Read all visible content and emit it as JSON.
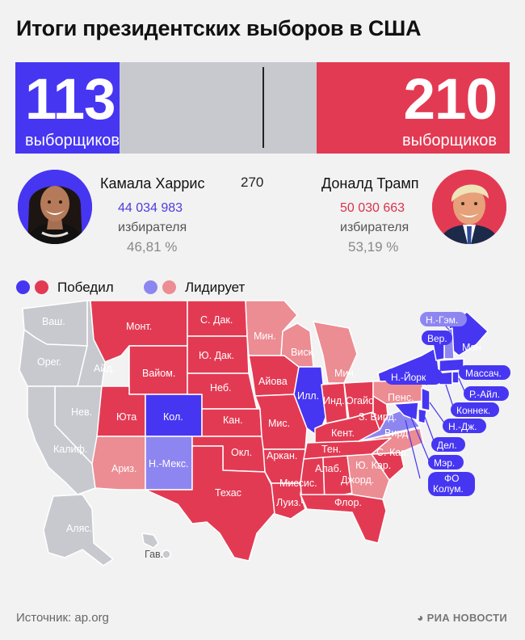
{
  "title": "Итоги президентских выборов в США",
  "chart_data": {
    "type": "bar",
    "categories": [
      "Камала Харрис",
      "Доналд Трамп"
    ],
    "series": [
      {
        "name": "выборщиков",
        "values": [
          113,
          210
        ]
      }
    ],
    "ylim": [
      0,
      538
    ],
    "threshold": 270,
    "popular_votes": [
      44034983,
      50030663
    ],
    "popular_pct": [
      46.81,
      53.19
    ]
  },
  "bar": {
    "left_number": "113",
    "left_label": "выборщиков",
    "right_number": "210",
    "right_label": "выборщиков",
    "threshold_label": "270",
    "colors": {
      "blue": "#4636f2",
      "red": "#e33a53",
      "undecided": "#c7c9cf"
    }
  },
  "candidates": {
    "left": {
      "name": "Камала Харрис",
      "votes": "44 034 983",
      "votes_label": "избирателя",
      "pct": "46,81 %"
    },
    "right": {
      "name": "Доналд Трамп",
      "votes": "50 030 663",
      "votes_label": "избирателя",
      "pct": "53,19 %"
    }
  },
  "legend": {
    "won": "Победил",
    "leading": "Лидирует",
    "colors": {
      "blue_won": "#4636f2",
      "red_won": "#e33a53",
      "blue_lead": "#8e86f0",
      "red_lead": "#ec8c93"
    }
  },
  "map": {
    "colors": {
      "grey": "#c7c9cf",
      "blue": "#4636f2",
      "red": "#e33a53",
      "lightred": "#ec8c93",
      "lightblue": "#8e86f0",
      "stroke": "#ffffff"
    },
    "labels": {
      "wa": "Ваш.",
      "or": "Орег.",
      "id": "Айд.",
      "nv": "Нев.",
      "ca": "Калиф.",
      "mt": "Монт.",
      "wy": "Вайом.",
      "ut": "Юта",
      "co": "Кол.",
      "az": "Ариз.",
      "nm": "Н.-Мекс.",
      "sd": "С. Дак.",
      "nd": "Ю. Дак.",
      "ne": "Неб.",
      "ks": "Кан.",
      "ok": "Окл.",
      "tx": "Техас",
      "mn": "Мин.",
      "ia": "Айова",
      "mo": "Мис.",
      "ar": "Аркан.",
      "la": "Луиз.",
      "wi": "Виск.",
      "il": "Илл.",
      "mi": "Мич.",
      "in": "Инд.",
      "oh": "Огайо",
      "ky": "Кент.",
      "tn": "Тен.",
      "ms": "Миссис.",
      "al": "Алаб.",
      "ga": "Джорд.",
      "fl": "Флор.",
      "sc": "Ю. Кар.",
      "nc": "С. Кар.",
      "va": "Вирд.",
      "wv": "З. Вирд.",
      "pa": "Пенс.",
      "ny": "Н.-Йорк",
      "me": "Мэн",
      "ak": "Аляс.",
      "hi": "Гав."
    },
    "pills": {
      "nh": "Н.-Гэм.",
      "vt": "Вер.",
      "ma": "Массач.",
      "ri": "Р.-Айл.",
      "ct": "Коннек.",
      "nj": "Н.-Дж.",
      "de": "Дел.",
      "md": "Мэр.",
      "dc1": "ФО",
      "dc2": "Колум."
    }
  },
  "footer": {
    "source": "Источник: ap.org",
    "brand": "РИА НОВОСТИ"
  }
}
